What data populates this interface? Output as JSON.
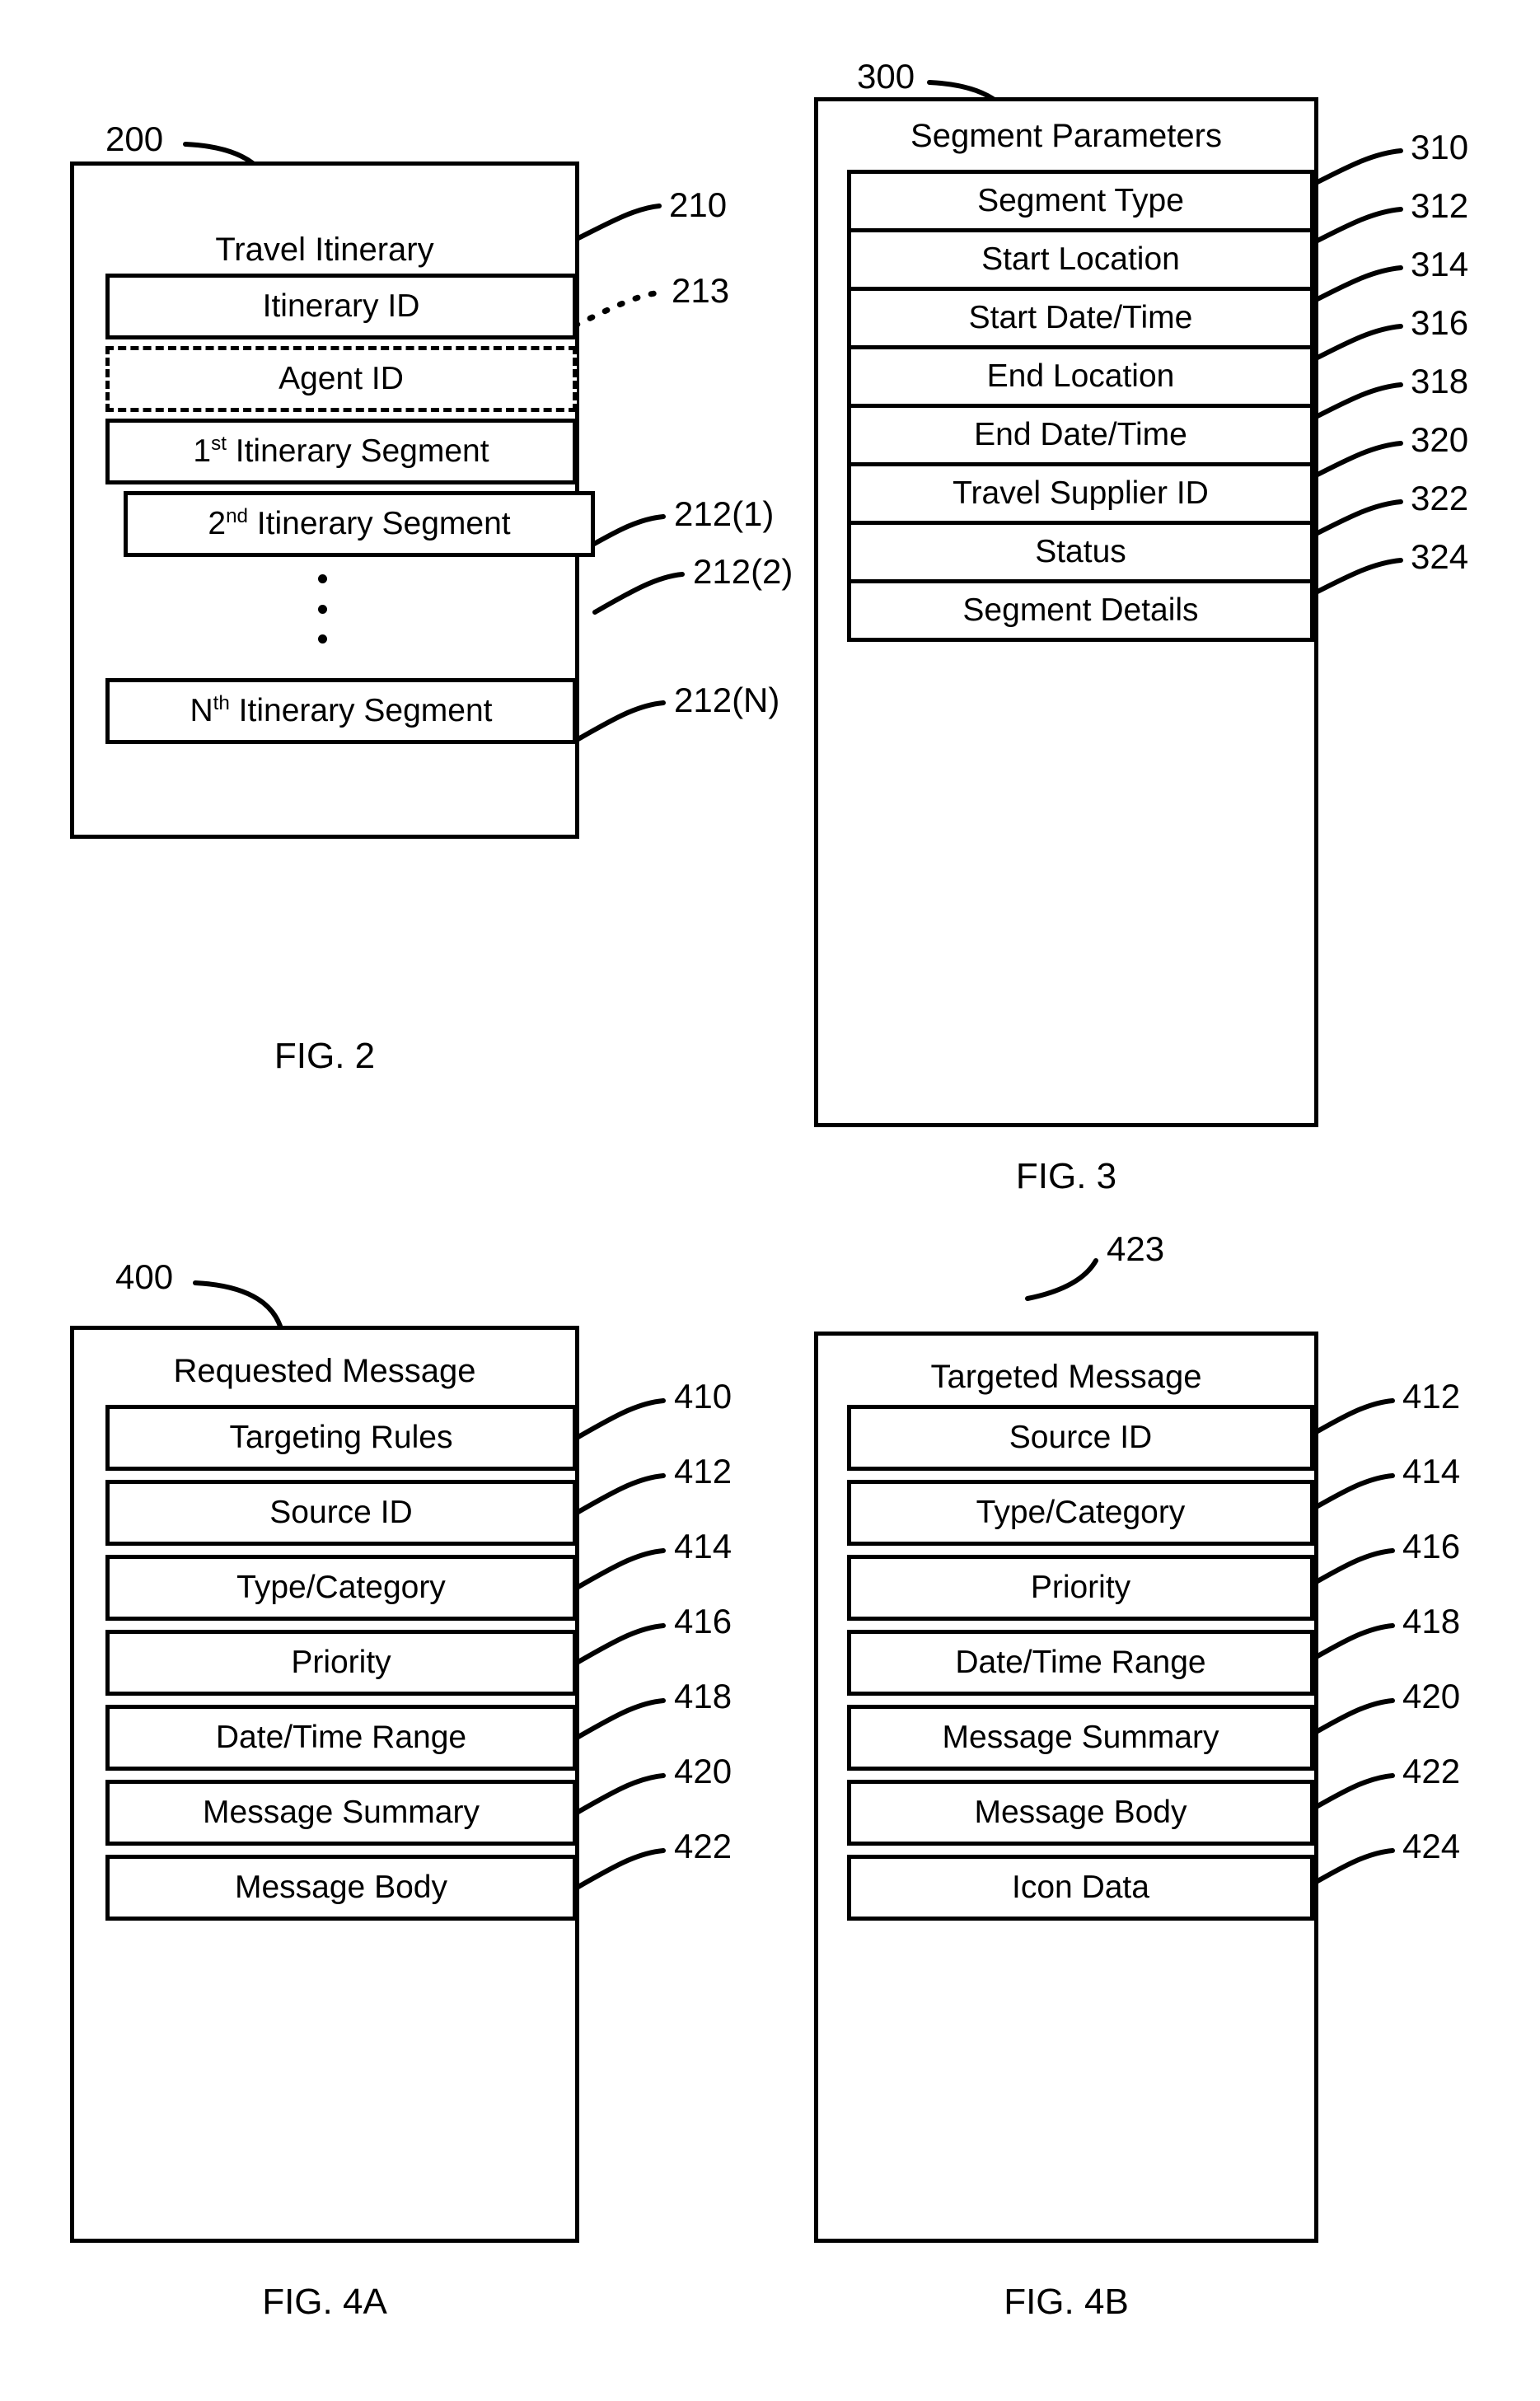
{
  "figures": [
    {
      "id": "fig2",
      "caption": "FIG. 2",
      "ref": "200",
      "title": "Travel Itinerary",
      "fields": [
        {
          "label": "Itinerary ID",
          "ref": "210",
          "style": "solid"
        },
        {
          "label": "Agent ID",
          "ref": "213",
          "style": "dashed"
        },
        {
          "label": "1st Itinerary Segment",
          "ref": "212(1)",
          "style": "solid",
          "prefix": "1",
          "sup": "st",
          "rest": " Itinerary Segment"
        },
        {
          "label": "2nd Itinerary Segment",
          "ref": "212(2)",
          "style": "solid",
          "prefix": "2",
          "sup": "nd",
          "rest": " Itinerary Segment"
        },
        {
          "label": "Nth Itinerary Segment",
          "ref": "212(N)",
          "style": "solid",
          "prefix": "N",
          "sup": "th",
          "rest": " Itinerary Segment"
        }
      ]
    },
    {
      "id": "fig3",
      "caption": "FIG. 3",
      "ref": "300",
      "title": "Segment Parameters",
      "fields": [
        {
          "label": "Segment Type",
          "ref": "310",
          "style": "solid"
        },
        {
          "label": "Start Location",
          "ref": "312",
          "style": "solid"
        },
        {
          "label": "Start Date/Time",
          "ref": "314",
          "style": "solid"
        },
        {
          "label": "End Location",
          "ref": "316",
          "style": "solid"
        },
        {
          "label": "End Date/Time",
          "ref": "318",
          "style": "solid"
        },
        {
          "label": "Travel Supplier ID",
          "ref": "320",
          "style": "solid"
        },
        {
          "label": "Status",
          "ref": "322",
          "style": "solid"
        },
        {
          "label": "Segment Details",
          "ref": "324",
          "style": "solid"
        }
      ]
    },
    {
      "id": "fig4a",
      "caption": "FIG. 4A",
      "ref": "400",
      "title": "Requested Message",
      "fields": [
        {
          "label": "Targeting Rules",
          "ref": "410",
          "style": "solid"
        },
        {
          "label": "Source ID",
          "ref": "412",
          "style": "solid"
        },
        {
          "label": "Type/Category",
          "ref": "414",
          "style": "solid"
        },
        {
          "label": "Priority",
          "ref": "416",
          "style": "solid"
        },
        {
          "label": "Date/Time Range",
          "ref": "418",
          "style": "solid"
        },
        {
          "label": "Message Summary",
          "ref": "420",
          "style": "solid"
        },
        {
          "label": "Message Body",
          "ref": "422",
          "style": "solid"
        }
      ]
    },
    {
      "id": "fig4b",
      "caption": "FIG. 4B",
      "ref": "423",
      "title": "Targeted Message",
      "fields": [
        {
          "label": "Source ID",
          "ref": "412",
          "style": "solid"
        },
        {
          "label": "Type/Category",
          "ref": "414",
          "style": "solid"
        },
        {
          "label": "Priority",
          "ref": "416",
          "style": "solid"
        },
        {
          "label": "Date/Time Range",
          "ref": "418",
          "style": "solid"
        },
        {
          "label": "Message Summary",
          "ref": "420",
          "style": "solid"
        },
        {
          "label": "Message Body",
          "ref": "422",
          "style": "solid"
        },
        {
          "label": "Icon Data",
          "ref": "424",
          "style": "solid"
        }
      ]
    }
  ],
  "fig2": {
    "ref": "200",
    "title": "Travel Itinerary",
    "caption": "FIG. 2",
    "f0": "Itinerary ID",
    "f1": "Agent ID",
    "f2_num": "1",
    "f2_sup": "st",
    "f2_rest": " Itinerary Segment",
    "f3_num": "2",
    "f3_sup": "nd",
    "f3_rest": " Itinerary Segment",
    "f4_num": "N",
    "f4_sup": "th",
    "f4_rest": " Itinerary Segment",
    "r0": "210",
    "r1": "213",
    "r2": "212(1)",
    "r3": "212(2)",
    "r4": "212(N)"
  },
  "fig3": {
    "ref": "300",
    "title": "Segment Parameters",
    "caption": "FIG. 3",
    "f0": "Segment Type",
    "f1": "Start Location",
    "f2": "Start Date/Time",
    "f3": "End Location",
    "f4": "End Date/Time",
    "f5": "Travel Supplier ID",
    "f6": "Status",
    "f7": "Segment Details",
    "r0": "310",
    "r1": "312",
    "r2": "314",
    "r3": "316",
    "r4": "318",
    "r5": "320",
    "r6": "322",
    "r7": "324"
  },
  "fig4a": {
    "ref": "400",
    "title": "Requested Message",
    "caption": "FIG. 4A",
    "f0": "Targeting Rules",
    "f1": "Source ID",
    "f2": "Type/Category",
    "f3": "Priority",
    "f4": "Date/Time Range",
    "f5": "Message Summary",
    "f6": "Message Body",
    "r0": "410",
    "r1": "412",
    "r2": "414",
    "r3": "416",
    "r4": "418",
    "r5": "420",
    "r6": "422"
  },
  "fig4b": {
    "ref": "423",
    "title": "Targeted Message",
    "caption": "FIG. 4B",
    "f0": "Source ID",
    "f1": "Type/Category",
    "f2": "Priority",
    "f3": "Date/Time Range",
    "f4": "Message Summary",
    "f5": "Message Body",
    "f6": "Icon Data",
    "r0": "412",
    "r1": "414",
    "r2": "416",
    "r3": "418",
    "r4": "420",
    "r5": "422",
    "r6": "424"
  },
  "colors": {
    "ink": "#000000",
    "paper": "#ffffff"
  }
}
